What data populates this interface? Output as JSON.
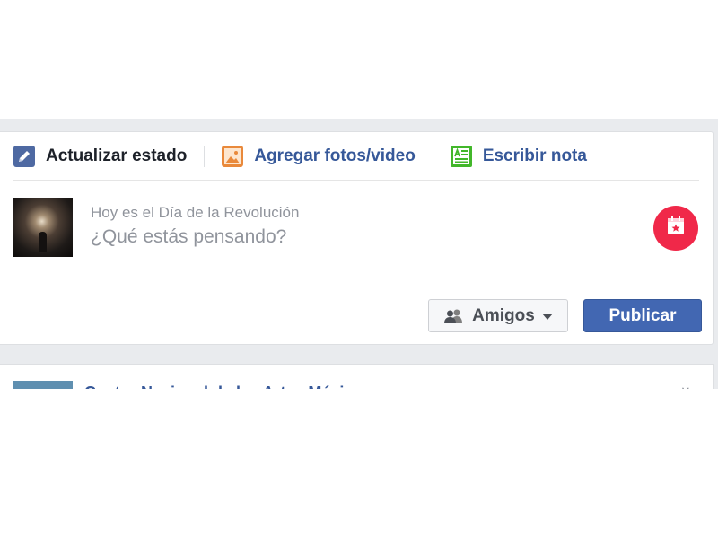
{
  "composer": {
    "tabs": [
      {
        "label": "Actualizar estado",
        "icon": "pencil-icon",
        "active": true
      },
      {
        "label": "Agregar fotos/video",
        "icon": "photo-icon",
        "active": false
      },
      {
        "label": "Escribir nota",
        "icon": "note-icon",
        "active": false
      }
    ],
    "subtitle": "Hoy es el Día de la Revolución",
    "placeholder": "¿Qué estás pensando?",
    "emoji_icon": "calendar-star-icon",
    "privacy_label": "Amigos",
    "privacy_icon": "friends-icon",
    "publish_label": "Publicar"
  },
  "next_post": {
    "title": "Centro Nacional de las Artes México"
  },
  "colors": {
    "link_blue": "#365899",
    "publish_blue": "#4267b2",
    "emoji_red": "#f02849",
    "feed_bg": "#e9ebee"
  }
}
